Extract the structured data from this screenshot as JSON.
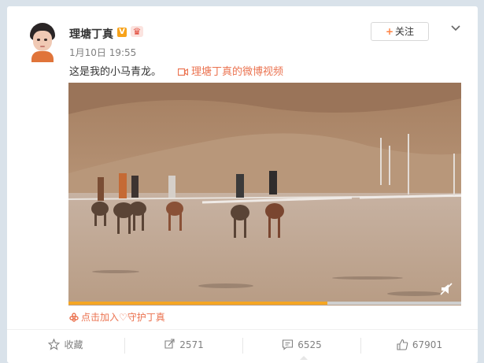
{
  "post": {
    "author": "理塘丁真",
    "verified_badge": "V",
    "time": "1月10日 19:55",
    "text": "这是我的小马青龙。",
    "video_link": "理塘丁真的微博视频",
    "promo": "点击加入♡守护丁真"
  },
  "header": {
    "follow_plus": "+",
    "follow_label": "关注"
  },
  "video": {
    "progress": 0.66
  },
  "actions": {
    "favorite_label": "收藏",
    "repost_count": "2571",
    "comment_count": "6525",
    "like_count": "67901"
  },
  "colors": {
    "accent": "#eb7350",
    "follow_plus": "#ff8140",
    "badge": "#f7a31b",
    "progress": "#f5a623"
  },
  "icons": [
    "chevron-down-icon",
    "video-icon",
    "flower-icon",
    "star-icon",
    "repost-icon",
    "comment-icon",
    "like-icon",
    "mute-icon"
  ]
}
